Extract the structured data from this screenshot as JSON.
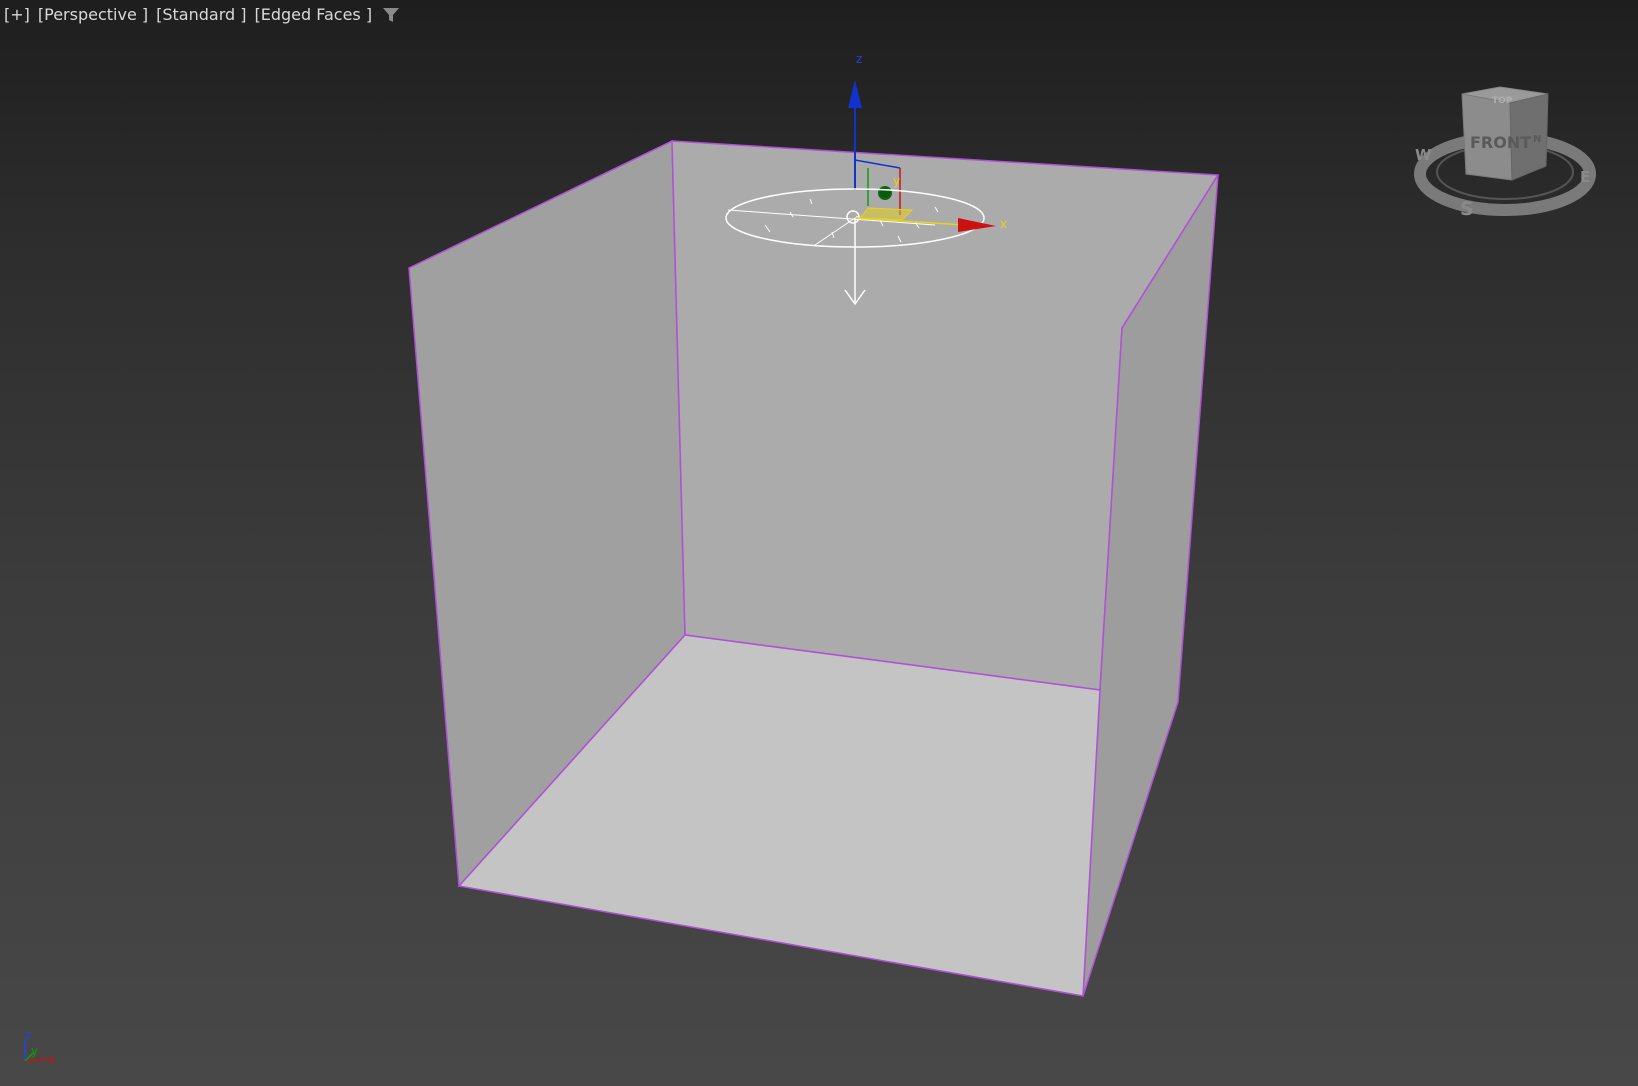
{
  "viewport": {
    "plus_menu": "[+]",
    "view_menu": "[Perspective ]",
    "shading_menu": "[Standard ]",
    "display_menu": "[Edged Faces ]",
    "filter_icon": "funnel-filter-icon",
    "background": "#2a2a2a"
  },
  "gizmo": {
    "x_label": "x",
    "y_label": "y",
    "z_label": "z",
    "x_color": "#cc1111",
    "y_color": "#119911",
    "z_color": "#1133cc",
    "highlight_color": "#e8d21a"
  },
  "viewcube": {
    "face_front": "FRONT",
    "face_top": "TOP",
    "compass_w": "W",
    "compass_s": "S",
    "compass_e": "E",
    "compass_n": "N"
  },
  "corner_axis": {
    "x_label": "x",
    "y_label": "y",
    "z_label": "z"
  },
  "scene": {
    "edge_color": "#b050d8"
  }
}
